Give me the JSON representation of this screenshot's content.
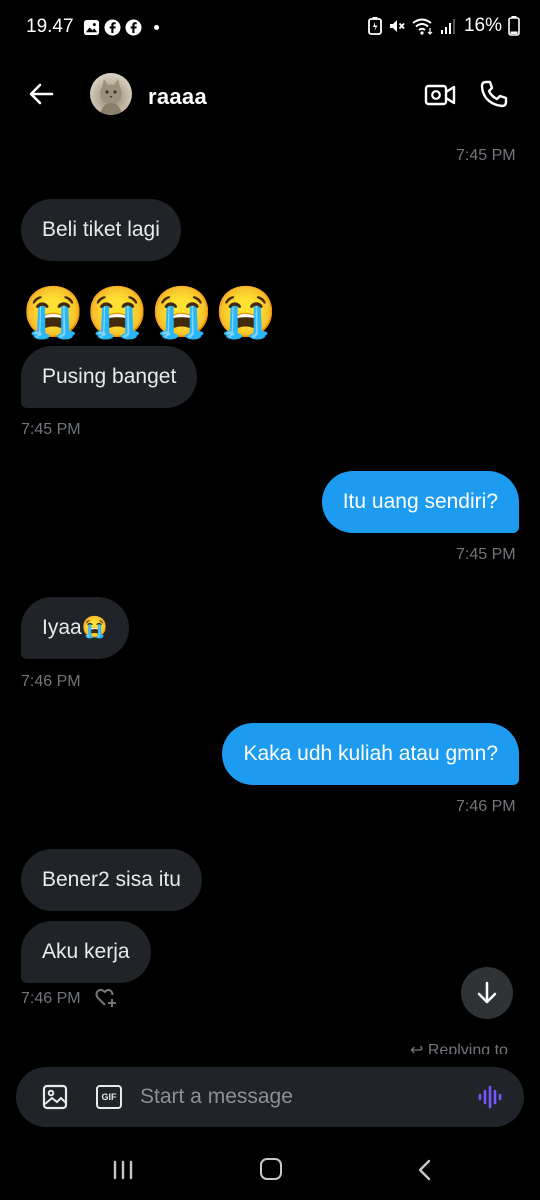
{
  "status_bar": {
    "time": "19.47",
    "battery": "16%",
    "left_icons": [
      "gallery-icon",
      "facebook-icon",
      "facebook-icon",
      "dot-icon"
    ],
    "right_icons": [
      "battery-saver-icon",
      "mute-icon",
      "wifi-icon",
      "signal-icon",
      "battery-icon"
    ]
  },
  "header": {
    "username": "raaaa",
    "icons": [
      "back-arrow-icon",
      "avatar",
      "video-call-icon",
      "phone-icon"
    ]
  },
  "messages": [
    {
      "time": "7:45 PM"
    },
    {
      "text": "Beli tiket lagi"
    },
    {
      "emoji": "😭😭😭😭"
    },
    {
      "text": "Pusing banget"
    },
    {
      "time": "7:45 PM"
    },
    {
      "text": "Itu uang sendiri?",
      "time": "7:45 PM"
    },
    {
      "text": "Iyaa😭",
      "time": "7:46 PM"
    },
    {
      "text": "Kaka udh kuliah atau gmn?",
      "time": "7:46 PM"
    },
    {
      "text": "Bener2 sisa itu"
    },
    {
      "text": "Aku kerja",
      "time": "7:46 PM"
    }
  ],
  "replying": "Replying to",
  "composer": {
    "placeholder": "Start a message",
    "icons": [
      "image-icon",
      "gif-icon",
      "voice-message-icon"
    ]
  },
  "colors": {
    "background": "#000000",
    "incoming_bubble": "#202327",
    "outgoing_bubble": "#1d9bf0",
    "timestamp": "#71767b",
    "voice_accent": "#7856ff"
  },
  "nav": {
    "icons": [
      "recent-apps-icon",
      "home-icon",
      "back-icon"
    ]
  }
}
